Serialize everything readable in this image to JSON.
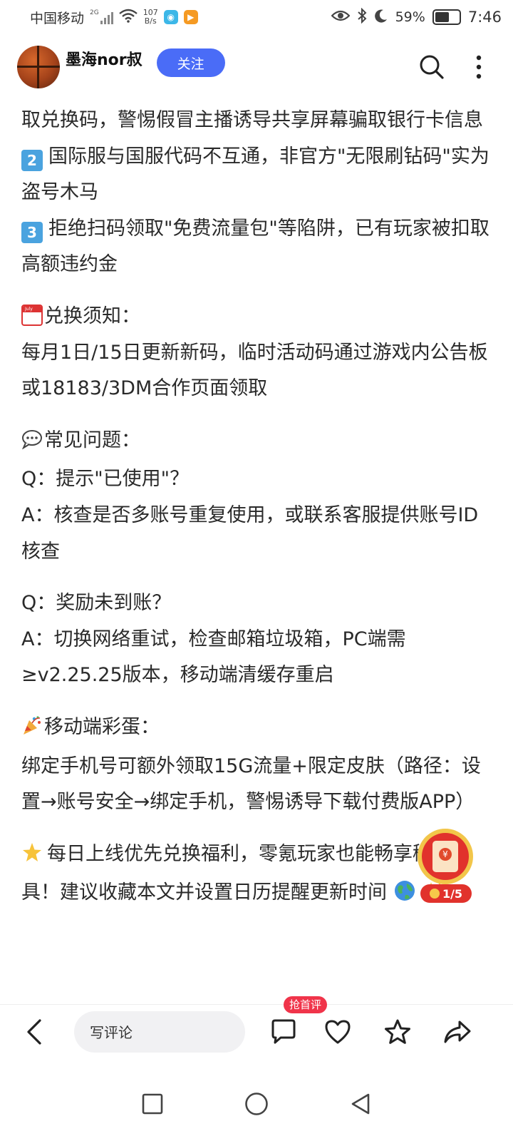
{
  "status_bar": {
    "carrier": "中国移动",
    "signal_type": "2G",
    "net_speed_value": "107",
    "net_speed_unit": "B/s",
    "battery": "59%",
    "battery_level": 0.59,
    "time": "7:46"
  },
  "header": {
    "username": "墨海nor叔",
    "follow_label": "关注"
  },
  "article": {
    "line1": "取兑换码，警惕假冒主播诱导共享屏幕骗取银行卡信息",
    "item2_num": "2",
    "item2_text": "国际服与国服代码不互通，非官方\"无限刷钻码\"实为盗号木马",
    "item3_num": "3",
    "item3_text": "拒绝扫码领取\"免费流量包\"等陷阱，已有玩家被扣取高额违约金",
    "section_notice_title": "兑换须知：",
    "calendar_label": "July",
    "section_notice_body": "每月1日/15日更新新码，临时活动码通过游戏内公告板或18183/3DM合作页面领取",
    "section_faq_title": "常见问题：",
    "faq1_q": "Q：提示\"已使用\"？",
    "faq1_a": "A：核查是否多账号重复使用，或联系客服提供账号ID核查",
    "faq2_q": "Q：奖励未到账？",
    "faq2_a": "A：切换网络重试，检查邮箱垃圾箱，PC端需≥v2.25.25版本，移动端清缓存重启",
    "section_egg_title": "移动端彩蛋：",
    "section_egg_body": "绑定手机号可额外领取15G流量+限定皮肤（路径：设置→账号安全→绑定手机，警惕诱导下载付费版APP）",
    "closing": "每日上线优先兑换福利，零氪玩家也能畅享稀有道具！建议收藏本文并设置日历提醒更新时间"
  },
  "red_packet": {
    "progress": "1/5"
  },
  "bottom_bar": {
    "comment_placeholder": "写评论",
    "first_comment_badge": "抢首评"
  },
  "colors": {
    "accent_blue": "#4a6cf7",
    "badge_red": "#f0344a",
    "packet_red": "#e1322c"
  }
}
